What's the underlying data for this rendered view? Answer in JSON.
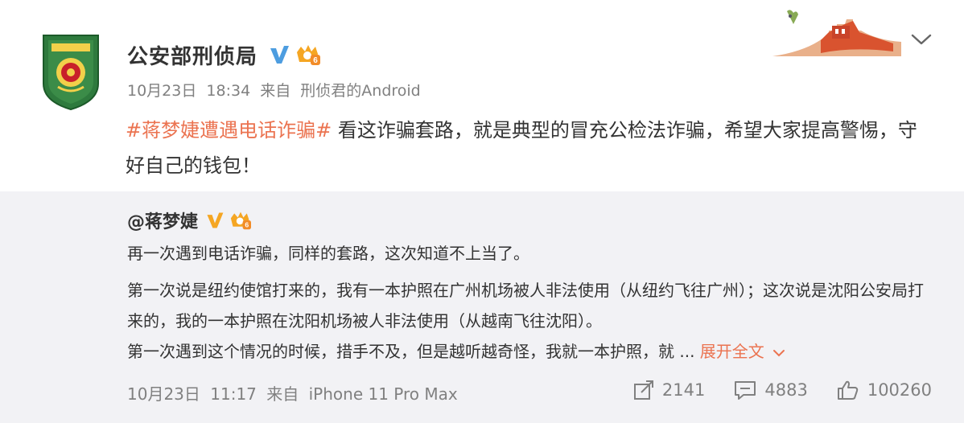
{
  "author": {
    "name": "公安部刑侦局",
    "avatar_icon": "police-badge-icon",
    "verified_icon": "verified-v-icon",
    "level_icon": "member-crown-icon"
  },
  "post": {
    "date": "10月23日",
    "time": "18:34",
    "from_label": "来自",
    "source": "刑侦君的Android",
    "hashtag": "#蒋梦婕遭遇电话诈骗#",
    "text": " 看这诈骗套路，就是典型的冒充公检法诈骗，希望大家提高警惕，守好自己的钱包！"
  },
  "repost": {
    "author": "@蒋梦婕",
    "line1": "再一次遇到电话诈骗，同样的套路，这次知道不上当了。",
    "line2": "第一次说是纽约使馆打来的，我有一本护照在广州机场被人非法使用（从纽约飞往广州）；这次说是沈阳公安局打来的，我的一本护照在沈阳机场被人非法使用（从越南飞往沈阳）。",
    "line3": "第一次遇到这个情况的时候，措手不及，但是越听越奇怪，我就一本护照，就 ...",
    "expand": "展开全文",
    "date": "10月23日",
    "time": "11:17",
    "from_label": "来自",
    "source": "iPhone 11 Pro Max",
    "reposts": "2141",
    "comments": "4883",
    "likes": "100260"
  },
  "colors": {
    "accent": "#eb7350",
    "meta": "#808080",
    "repost_bg": "#f2f2f5",
    "verified": "#4d9de0",
    "level": "#f5a623"
  },
  "icons": {
    "menu": "chevron-down-icon",
    "repost": "repost-icon",
    "comment": "comment-icon",
    "like": "thumbs-up-icon",
    "expand": "chevron-down-icon",
    "decoration": "great-wall-icon"
  }
}
